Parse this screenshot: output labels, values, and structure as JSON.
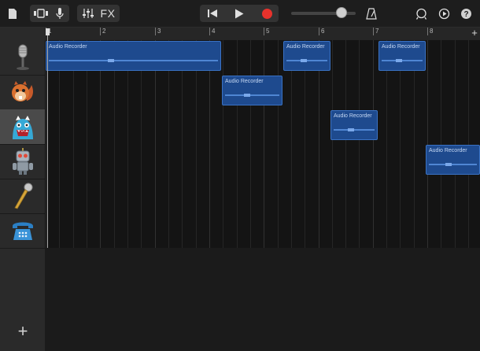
{
  "toolbar": {
    "fx_label": "FX"
  },
  "colors": {
    "region_fill": "#1e4a8e",
    "region_border": "#3a72c4",
    "record": "#e8322c",
    "selected_header": "#4a4a4a"
  },
  "ruler": {
    "bars": [
      "1",
      "2",
      "3",
      "4",
      "5",
      "6",
      "7",
      "8"
    ]
  },
  "tracks": [
    {
      "icon": "microphone-icon",
      "selected": false
    },
    {
      "icon": "chipmunk-icon",
      "selected": false
    },
    {
      "icon": "monster-icon",
      "selected": true
    },
    {
      "icon": "robot-icon",
      "selected": false
    },
    {
      "icon": "handheld-mic-icon",
      "selected": false
    },
    {
      "icon": "telephone-icon",
      "selected": false
    }
  ],
  "regions": [
    {
      "track": 1,
      "label": "Audio Recorder"
    },
    {
      "track": 1,
      "label": "Audio Recorder"
    },
    {
      "track": 1,
      "label": "Audio Recorder"
    },
    {
      "track": 2,
      "label": "Audio Recorder"
    },
    {
      "track": 3,
      "label": "Audio Recorder"
    },
    {
      "track": 4,
      "label": "Audio Recorder"
    }
  ]
}
